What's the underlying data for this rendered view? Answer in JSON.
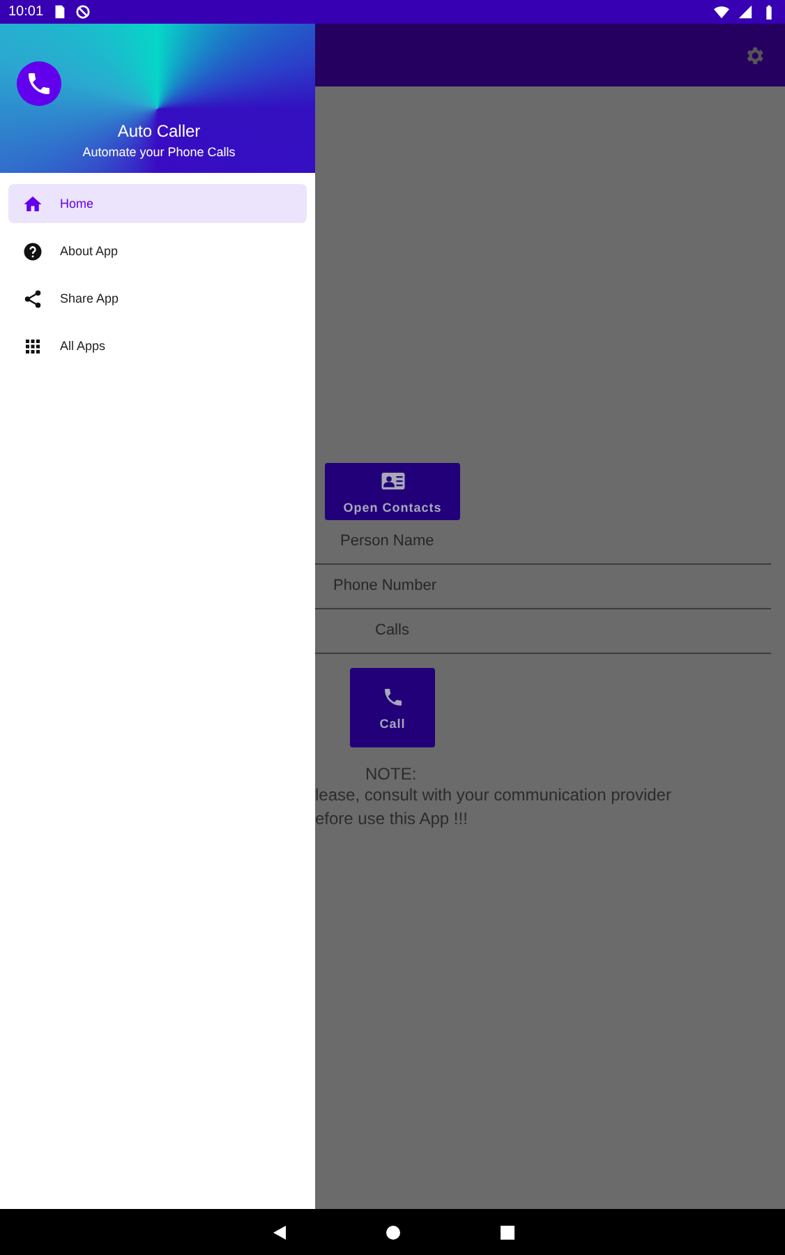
{
  "status_bar": {
    "time": "10:01"
  },
  "drawer": {
    "title": "Auto Caller",
    "subtitle": "Automate your Phone Calls",
    "items": [
      {
        "label": "Home",
        "kind": "home",
        "selected": true
      },
      {
        "label": "About App",
        "kind": "help",
        "selected": false
      },
      {
        "label": "Share App",
        "kind": "share",
        "selected": false
      },
      {
        "label": "All Apps",
        "kind": "apps",
        "selected": false
      }
    ]
  },
  "main": {
    "open_contacts": "Open Contacts",
    "fields": [
      {
        "placeholder": "Person Name"
      },
      {
        "placeholder": "Phone Number"
      },
      {
        "placeholder": "Calls"
      }
    ],
    "call": "Call",
    "note_title": "NOTE:",
    "note_lines": [
      "lease, consult with your communication provider",
      "efore use this App !!!"
    ]
  }
}
